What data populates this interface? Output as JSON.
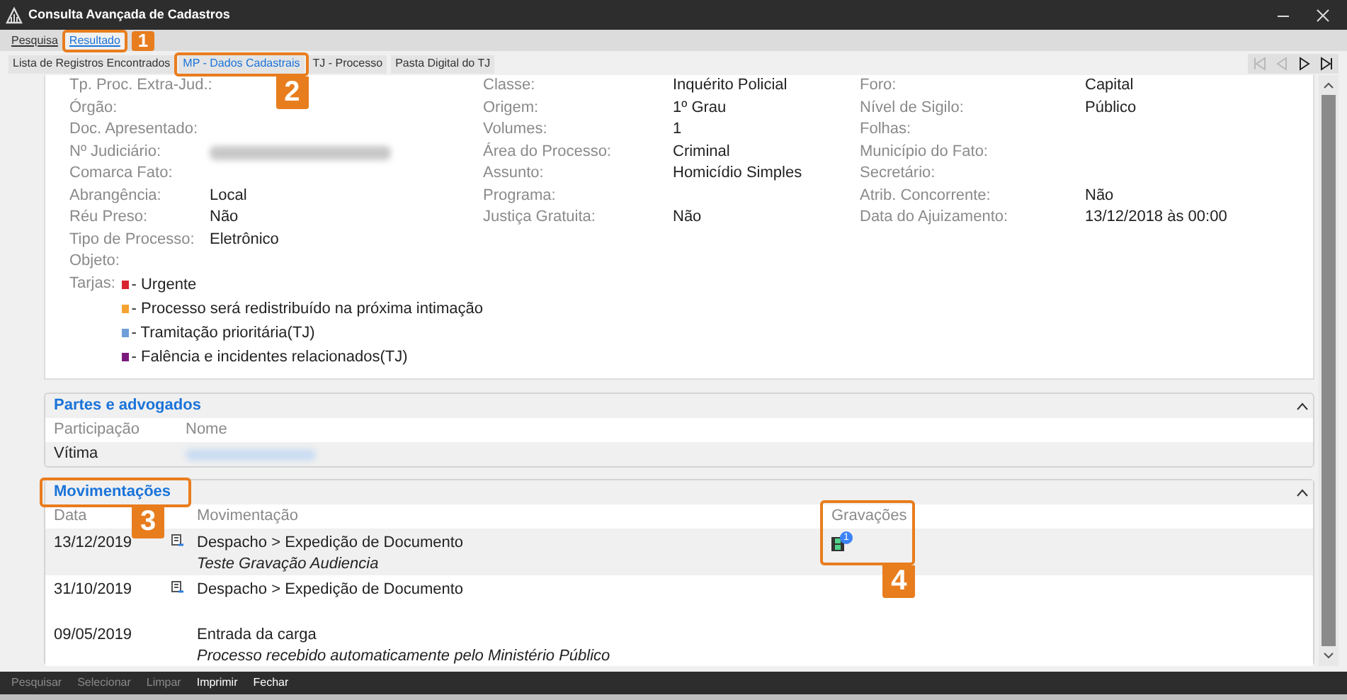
{
  "window": {
    "title": "Consulta Avançada de Cadastros"
  },
  "tabs": [
    {
      "label": "Pesquisa",
      "selected": false
    },
    {
      "label": "Resultado",
      "selected": true
    }
  ],
  "subtabs": [
    {
      "label": "Lista de Registros Encontrados",
      "selected": false
    },
    {
      "label": "MP - Dados Cadastrais",
      "selected": true
    },
    {
      "label": "TJ - Processo",
      "selected": false
    },
    {
      "label": "Pasta Digital do TJ",
      "selected": false
    }
  ],
  "nav_buttons": [
    {
      "kind": "first",
      "disabled": true
    },
    {
      "kind": "prev",
      "disabled": true
    },
    {
      "kind": "next",
      "disabled": false
    },
    {
      "kind": "last",
      "disabled": false
    }
  ],
  "details": {
    "columns": [
      [
        {
          "label": "Tp. Proc. Extra-Jud.:"
        },
        {
          "label": "Órgão:"
        },
        {
          "label": "Doc. Apresentado:"
        },
        {
          "label": "Nº Judiciário:",
          "redacted": true
        },
        {
          "label": "Comarca Fato:"
        },
        {
          "label": "Abrangência:",
          "value": "Local"
        },
        {
          "label": "Réu Preso:",
          "value": "Não"
        },
        {
          "label": "Tipo de Processo:",
          "value": "Eletrônico"
        },
        {
          "label": "Objeto:"
        }
      ],
      [
        {
          "label": "Classe:",
          "value": "Inquérito Policial"
        },
        {
          "label": "Origem:",
          "value": "1º Grau"
        },
        {
          "label": "Volumes:",
          "value": "1"
        },
        {
          "label": "Área do Processo:",
          "value": "Criminal"
        },
        {
          "label": "Assunto:",
          "value": "Homicídio Simples"
        },
        {
          "label": "Programa:"
        },
        {
          "label": "Justiça Gratuita:",
          "value": "Não"
        }
      ],
      [
        {
          "label": "Foro:",
          "value": "Capital"
        },
        {
          "label": "Nível de Sigilo:",
          "value": "Público"
        },
        {
          "label": "Folhas:"
        },
        {
          "label": "Município do Fato:"
        },
        {
          "label": "Secretário:"
        },
        {
          "label": "Atrib. Concorrente:",
          "value": "Não"
        },
        {
          "label": "Data do Ajuizamento:",
          "value": "13/12/2018 às 00:00"
        }
      ]
    ],
    "tarjas_label": "Tarjas:",
    "tarjas": [
      {
        "text": "- Urgente",
        "color": "#d9252d"
      },
      {
        "text": "- Processo será redistribuído na próxima intimação",
        "color": "#f5a431"
      },
      {
        "text": "- Tramitação prioritária(TJ)",
        "color": "#6f9fd8"
      },
      {
        "text": "- Falência e incidentes relacionados(TJ)",
        "color": "#7b1a7d"
      }
    ]
  },
  "partes": {
    "title": "Partes e advogados",
    "expanded": true,
    "columns": [
      "Participação",
      "Nome"
    ],
    "rows": [
      {
        "participacao": "Vítima",
        "nome_redacted": true
      }
    ]
  },
  "movimentacoes": {
    "title": "Movimentações",
    "expanded": true,
    "columns": [
      "Data",
      "Movimentação",
      "Gravações"
    ],
    "rows": [
      {
        "date": "13/12/2019",
        "kind": "document",
        "title": "Despacho > Expedição de Documento",
        "note": "Teste Gravação Audiencia",
        "recordings": "1"
      },
      {
        "date": "31/10/2019",
        "kind": "document",
        "title": "Despacho > Expedição de Documento"
      },
      {
        "date": "09/05/2019",
        "kind": "plain",
        "title": "Entrada da carga",
        "note": "Processo recebido automaticamente pelo Ministério Público"
      }
    ]
  },
  "footer_buttons": [
    {
      "label": "Pesquisar",
      "disabled": true
    },
    {
      "label": "Selecionar",
      "disabled": true
    },
    {
      "label": "Limpar",
      "disabled": true
    },
    {
      "label": "Imprimir",
      "disabled": false
    },
    {
      "label": "Fechar",
      "disabled": false
    }
  ],
  "callouts": [
    "1",
    "2",
    "3",
    "4"
  ]
}
